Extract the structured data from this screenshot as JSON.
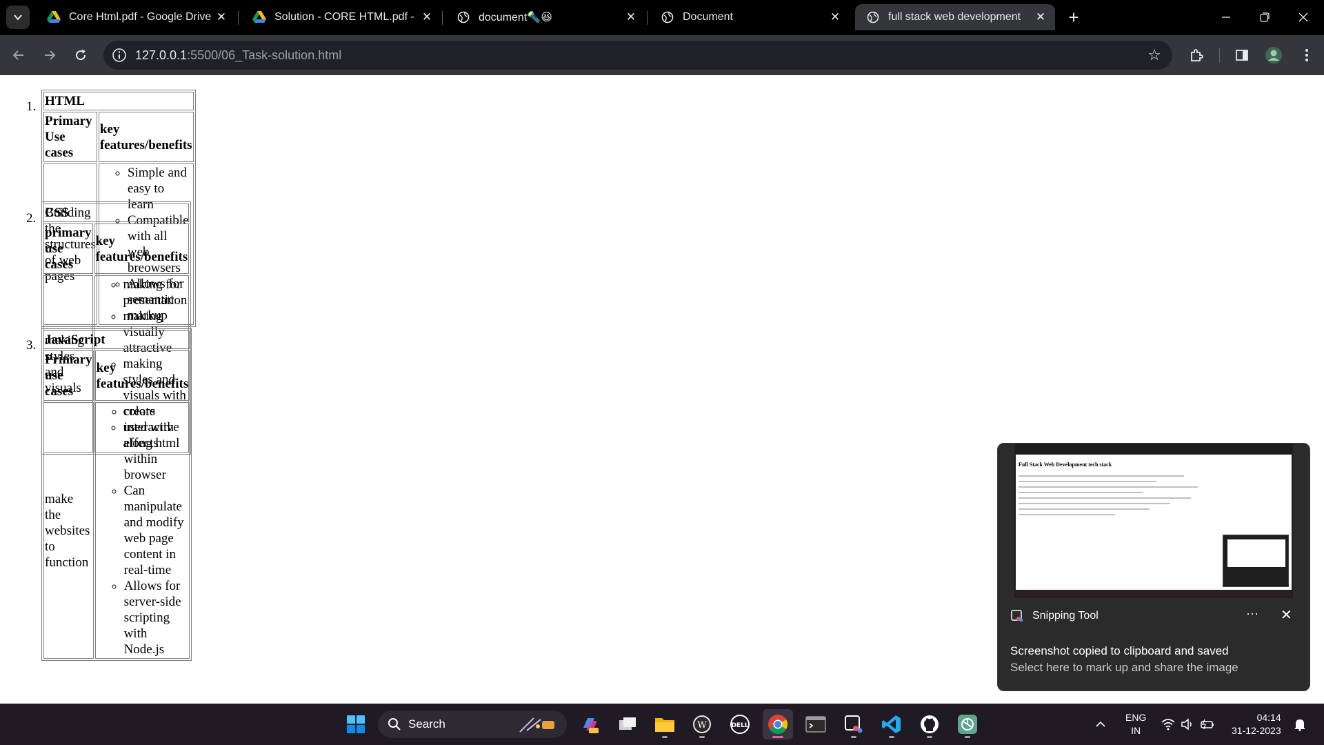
{
  "browser": {
    "tabs": [
      {
        "title": "Core Html.pdf - Google Drive",
        "favicon": "google-drive-icon",
        "active": false
      },
      {
        "title": "Solution - CORE HTML.pdf - Go",
        "favicon": "google-drive-icon",
        "active": false
      },
      {
        "title": "document🔦😆",
        "favicon": "globe-icon",
        "active": false
      },
      {
        "title": "Document",
        "favicon": "globe-icon",
        "active": false
      },
      {
        "title": "full stack web development",
        "favicon": "globe-icon",
        "active": true
      }
    ],
    "url_host": "127.0.0.1",
    "url_rest": ":5500/06_Task-solution.html"
  },
  "page": {
    "sections": [
      {
        "number": "1.",
        "title": "HTML",
        "col1_header": "Primary Use cases",
        "col2_header": "key features/benefits",
        "use_case": "Building the structures of web pages",
        "features": [
          "Simple and easy to learn",
          "Compatible with all web breowsers",
          "Allows for semantic markup"
        ]
      },
      {
        "number": "2.",
        "title": "CSS",
        "col1_header": "primary use cases",
        "col2_header": "key features/benefits",
        "use_case": "making styles and visuals",
        "features": [
          "making for presentation",
          "making visually attractive",
          "making styles and visuals with colors",
          "used with along html"
        ]
      },
      {
        "number": "3.",
        "title": "JavaScript",
        "col1_header": "Primary use cases",
        "col2_header": "key features/benefits",
        "use_case": "make the websites to function",
        "features": [
          "create interactive effects within browser",
          "Can manipulate and modify web page content in real-time",
          "Allows for server-side scripting with Node.js"
        ]
      }
    ]
  },
  "notification": {
    "app_name": "Snipping Tool",
    "title": "Screenshot copied to clipboard and saved",
    "subtitle": "Select here to mark up and share the image",
    "preview_heading": "Full Stack Web Development tech stack"
  },
  "taskbar": {
    "search_placeholder": "Search",
    "language": "ENG",
    "region": "IN",
    "time": "04:14",
    "date": "31-12-2023",
    "pinned": [
      "copilot-icon",
      "task-view-icon",
      "file-explorer-icon",
      "wordpad-icon",
      "dell-icon",
      "chrome-icon",
      "terminal-icon",
      "snipping-tool-icon",
      "vscode-icon",
      "github-icon",
      "chatgpt-icon"
    ]
  },
  "colors": {
    "tab_strip": "#000000",
    "toolbar": "#35363a",
    "taskbar": "#1f1a24",
    "chrome_active_indicator": "#e05fa0"
  }
}
